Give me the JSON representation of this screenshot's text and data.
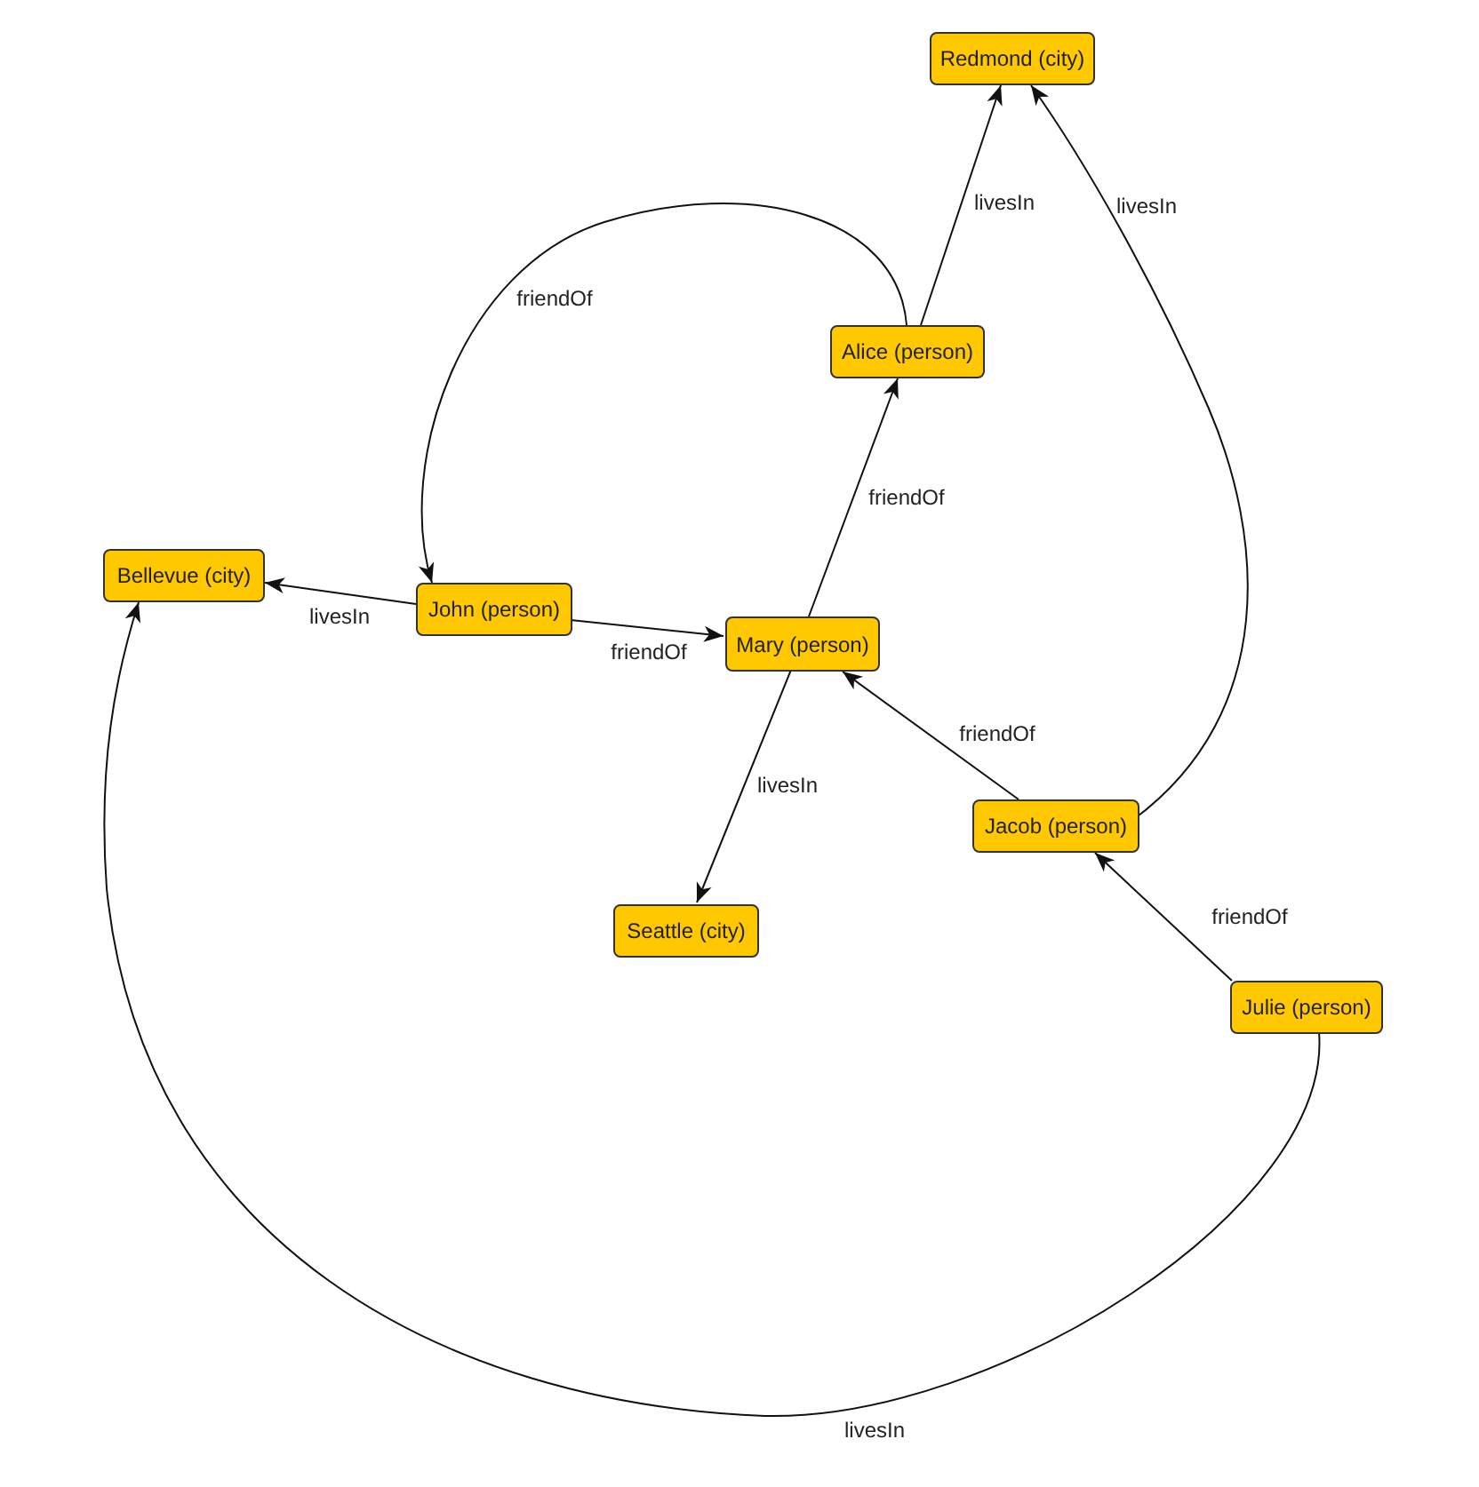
{
  "graph": {
    "nodes": [
      {
        "label": "Redmond (city)"
      },
      {
        "label": "Alice (person)"
      },
      {
        "label": "Bellevue (city)"
      },
      {
        "label": "John (person)"
      },
      {
        "label": "Mary (person)"
      },
      {
        "label": "Jacob (person)"
      },
      {
        "label": "Seattle (city)"
      },
      {
        "label": "Julie (person)"
      }
    ],
    "edges": [
      {
        "label": "livesIn"
      },
      {
        "label": "livesIn"
      },
      {
        "label": "friendOf"
      },
      {
        "label": "livesIn"
      },
      {
        "label": "friendOf"
      },
      {
        "label": "friendOf"
      },
      {
        "label": "livesIn"
      },
      {
        "label": "friendOf"
      },
      {
        "label": "friendOf"
      },
      {
        "label": "livesIn"
      }
    ]
  }
}
